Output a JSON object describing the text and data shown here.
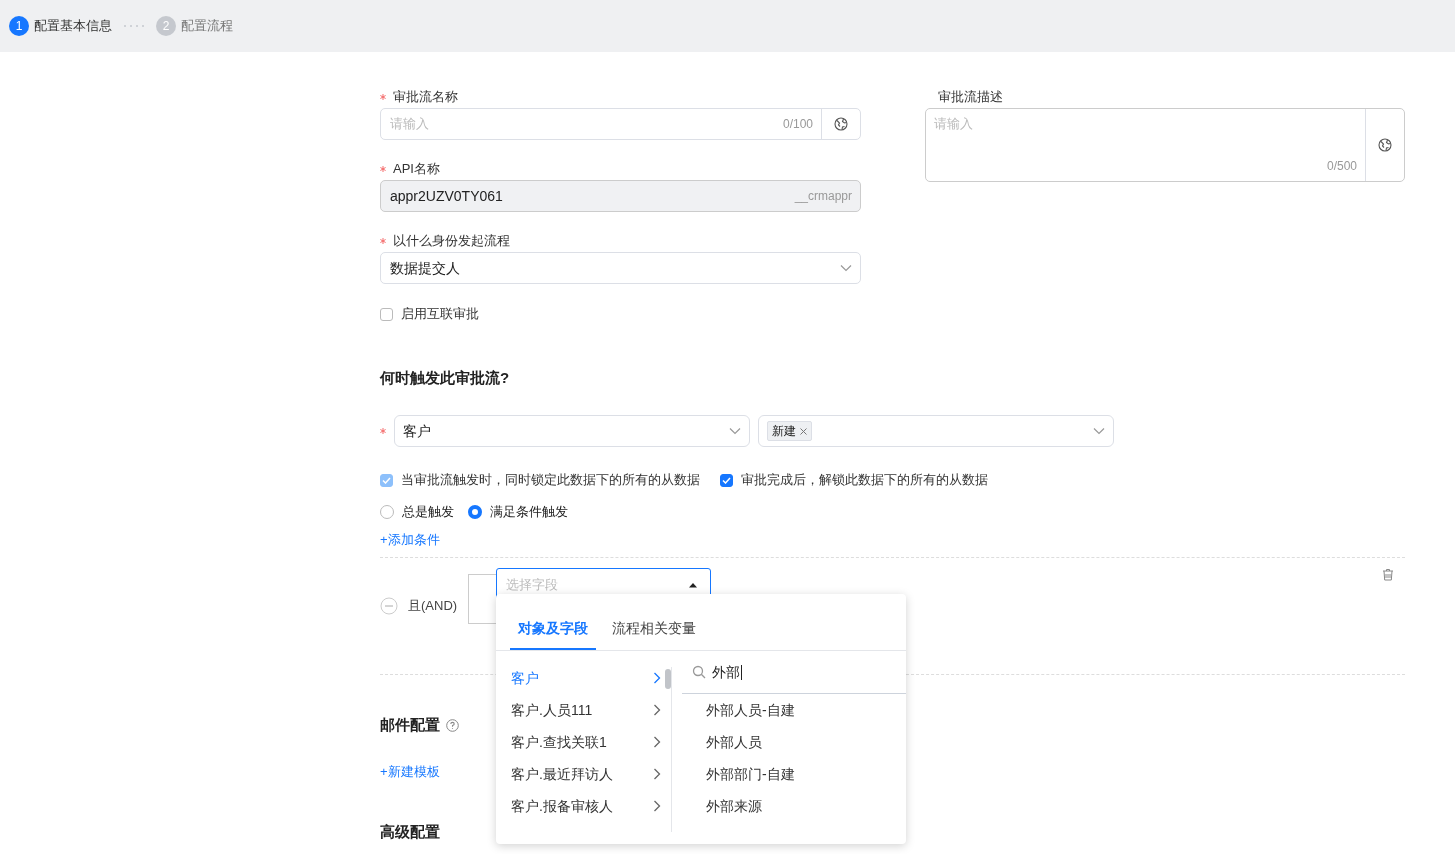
{
  "steps": [
    {
      "number": "1",
      "label": "配置基本信息",
      "selected": true
    },
    {
      "number": "2",
      "label": "配置流程",
      "selected": false
    }
  ],
  "basic": {
    "name_field": {
      "label": "审批流名称",
      "required": true,
      "placeholder": "请输入",
      "counter": "0/100"
    },
    "api_field": {
      "label": "API名称",
      "required": true,
      "value": "appr2UZV0TY061",
      "suffix": "__crmappr",
      "disabled": true
    },
    "initiator": {
      "label": "以什么身份发起流程",
      "required": true,
      "value": "数据提交人"
    },
    "description": {
      "label": "审批流描述",
      "placeholder": "请输入",
      "counter": "0/500"
    },
    "interconnect": {
      "label": "启用互联审批",
      "checked": false
    }
  },
  "trigger": {
    "heading": "何时触发此审批流?",
    "object_select": {
      "value": "客户",
      "required": true
    },
    "action_select": {
      "tags": [
        "新建"
      ]
    },
    "lock_options": [
      {
        "label": "当审批流触发时，同时锁定此数据下的所有的从数据",
        "checked": true,
        "disabled": true
      },
      {
        "label": "审批完成后，解锁此数据下的所有的从数据",
        "checked": true,
        "disabled": false
      }
    ],
    "modes": [
      {
        "label": "总是触发",
        "selected": false
      },
      {
        "label": "满足条件触发",
        "selected": true
      }
    ],
    "add_condition": "+添加条件"
  },
  "condition": {
    "logic": "且(AND)",
    "field_select": {
      "placeholder": "选择字段",
      "expanded": true
    }
  },
  "popup": {
    "tabs": [
      {
        "label": "对象及字段",
        "selected": true
      },
      {
        "label": "流程相关变量",
        "selected": false
      }
    ],
    "objects": [
      {
        "label": "客户",
        "selected": true
      },
      {
        "label": "客户.人员111",
        "selected": false
      },
      {
        "label": "客户.查找关联1",
        "selected": false
      },
      {
        "label": "客户.最近拜访人",
        "selected": false
      },
      {
        "label": "客户.报备审核人",
        "selected": false
      }
    ],
    "search": {
      "value": "外部"
    },
    "results": [
      "外部人员-自建",
      "外部人员",
      "外部部门-自建",
      "外部来源"
    ]
  },
  "mail": {
    "heading": "邮件配置",
    "add_template": "+新建模板"
  },
  "advanced": {
    "heading": "高级配置"
  }
}
